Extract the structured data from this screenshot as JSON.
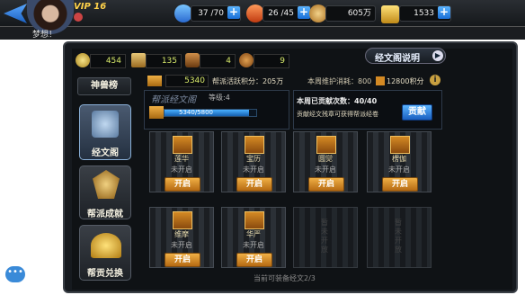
{
  "player": {
    "vip": "VIP 16",
    "signature": "梦想！"
  },
  "resources": {
    "stamina": "37 /70",
    "energy": "26 /45",
    "coins": "605万",
    "gold": "1533"
  },
  "stats": {
    "coins": "454",
    "item2": "135",
    "item3": "4",
    "item4": "9"
  },
  "left_menu": {
    "top_label": "神兽榜",
    "items": [
      "经文阁",
      "帮派成就",
      "帮贡兑换"
    ]
  },
  "header": {
    "explain_label": "经文阁说明",
    "points_value": "5340",
    "guild_points": "帮派活跃积分：205万",
    "weekly_cost_label": "本周维护消耗：800",
    "weekly_cost_points": "12800积分"
  },
  "hall": {
    "title": "帮派经文阁",
    "level": "等级:4",
    "progress_text": "5340/5800",
    "progress": 0.92
  },
  "contrib": {
    "count": "本周已贡献次数：40/40",
    "desc": "贡献经文残章可获得帮派经卷",
    "button": "贡献"
  },
  "slots": [
    {
      "name": "莲华",
      "status": "未开启",
      "button": "开启"
    },
    {
      "name": "宝历",
      "status": "未开启",
      "button": "开启"
    },
    {
      "name": "圆觉",
      "status": "未开启",
      "button": "开启"
    },
    {
      "name": "楞伽",
      "status": "未开启",
      "button": "开启"
    },
    {
      "name": "维摩",
      "status": "未开启",
      "button": "开启"
    },
    {
      "name": "华严",
      "status": "未开启",
      "button": "开启"
    }
  ],
  "locked_slot_text": "暂未开放",
  "footer": "当前可装备经文2/3",
  "colors": {
    "accent": "#f0b045",
    "button_blue": "#1a6fd6"
  }
}
